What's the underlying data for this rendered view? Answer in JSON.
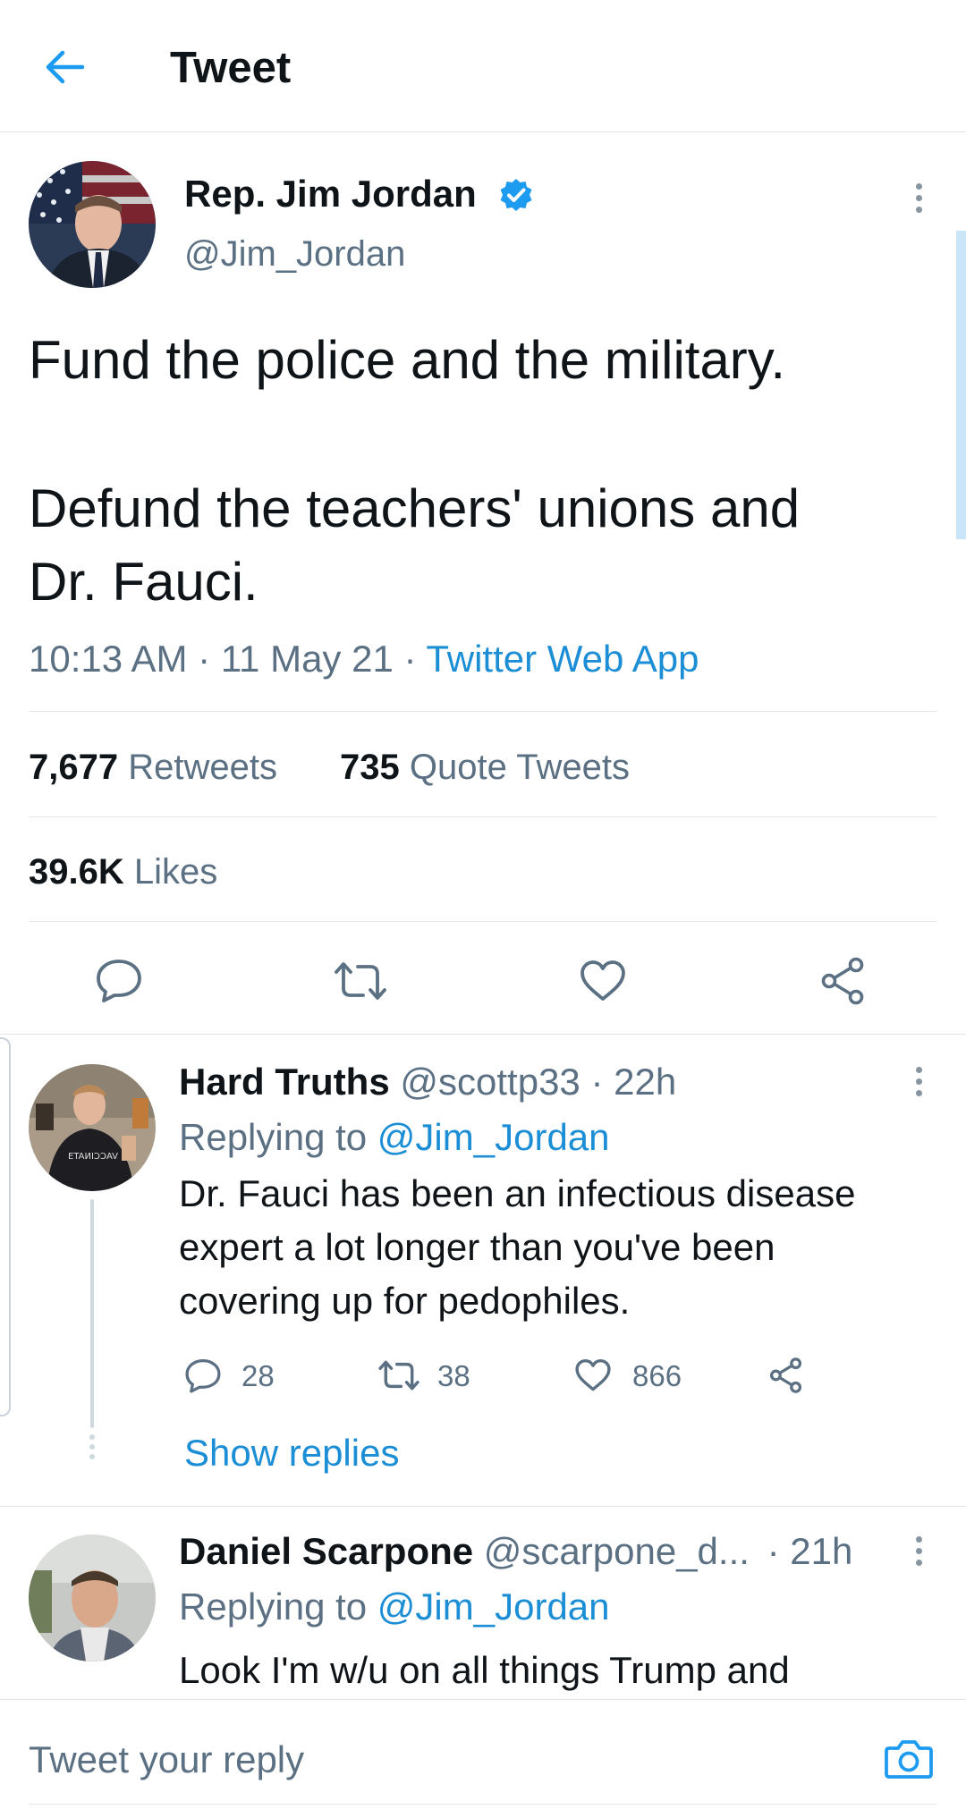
{
  "header": {
    "title": "Tweet"
  },
  "tweet": {
    "author_name": "Rep. Jim Jordan",
    "handle": "@Jim_Jordan",
    "text_line1": "Fund the police and the military.",
    "text_line2": "Defund the teachers' unions and",
    "text_line3": "Dr. Fauci.",
    "time": "10:13 AM",
    "date": "11 May 21",
    "source": "Twitter Web App",
    "separator": "·",
    "retweets_count": "7,677",
    "retweets_label": "Retweets",
    "quotes_count": "735",
    "quotes_label": "Quote Tweets",
    "likes_count": "39.6K",
    "likes_label": "Likes"
  },
  "replies": [
    {
      "name": "Hard Truths",
      "handle": "@scottp33",
      "time": "· 22h",
      "replying_prefix": "Replying to",
      "replying_handle": "@Jim_Jordan",
      "text_line1": "Dr. Fauci has been an infectious disease",
      "text_line2": "expert a lot longer than you've been",
      "text_line3": "covering up for pedophiles.",
      "reply_count": "28",
      "retweet_count": "38",
      "like_count": "866",
      "show_replies": "Show replies"
    },
    {
      "name": "Daniel Scarpone",
      "handle": "@scarpone_d...",
      "time": "· 21h",
      "replying_prefix": "Replying to",
      "replying_handle": "@Jim_Jordan",
      "text_line1": "Look I'm w/u on all things Trump and"
    }
  ],
  "composer": {
    "placeholder": "Tweet your reply"
  },
  "icons": {
    "back": "arrow-left-icon",
    "verified": "verified-badge-icon",
    "more": "more-vertical-icon",
    "reply": "reply-icon",
    "retweet": "retweet-icon",
    "like": "heart-icon",
    "share": "share-icon",
    "camera": "camera-icon"
  },
  "colors": {
    "accent": "#1d9bf0",
    "text_primary": "#0f1419",
    "text_secondary": "#5b7083",
    "divider": "#e1e6ea"
  }
}
